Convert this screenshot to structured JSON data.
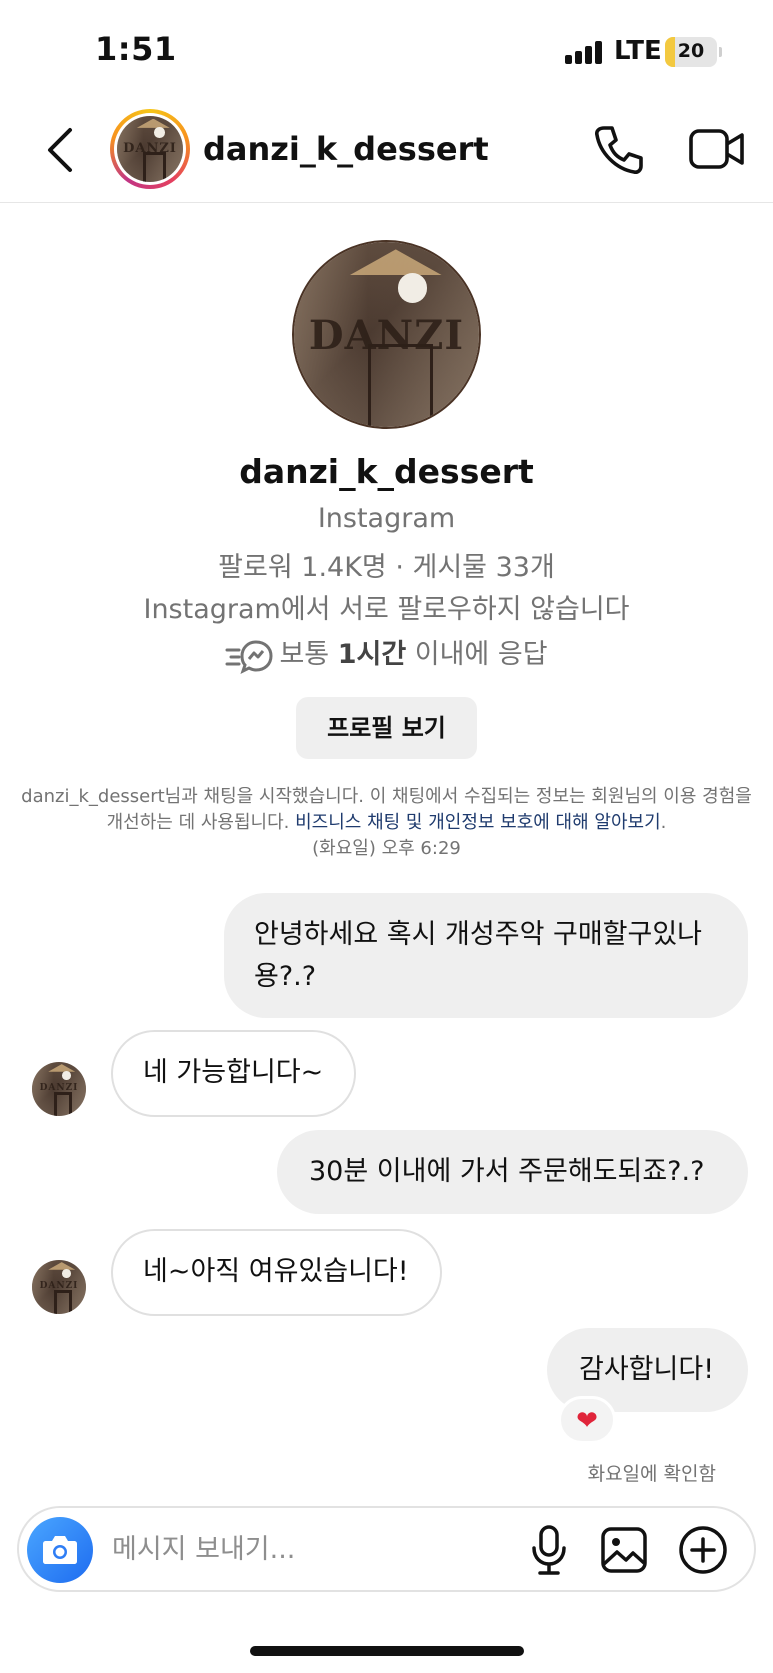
{
  "status_bar": {
    "time": "1:51",
    "network": "LTE",
    "battery": "20",
    "battery_level_percent": 20
  },
  "header": {
    "title": "danzi_k_dessert",
    "avatar_text": "DANZI"
  },
  "profile": {
    "avatar_text": "DANZI",
    "username": "danzi_k_dessert",
    "platform": "Instagram",
    "stats": "팔로워 1.4K명 · 게시물 33개",
    "follow_status": "Instagram에서 서로 팔로우하지 않습니다",
    "response_prefix": "보통 ",
    "response_time": "1시간",
    "response_suffix": " 이내에 응답",
    "view_profile_label": "프로필 보기"
  },
  "notice": {
    "text": "danzi_k_dessert님과 채팅을 시작했습니다. 이 채팅에서 수집되는 정보는 회원님의 이용 경험을 개선하는 데 사용됩니다. ",
    "link": "비즈니스 채팅 및 개인정보 보호에 대해 알아보기",
    "link_suffix": ".",
    "timestamp": "(화요일) 오후 6:29"
  },
  "messages": [
    {
      "from": "me",
      "text_line1": "안녕하세요 혹시 개성주악 구매할구있나",
      "text_line2": "용?.?"
    },
    {
      "from": "them",
      "text": "네 가능합니다~"
    },
    {
      "from": "me",
      "text": "30분 이내에 가서 주문해도되죠?.?"
    },
    {
      "from": "them",
      "text": "네~아직 여유있습니다!"
    },
    {
      "from": "me",
      "text": "감사합니다!",
      "reaction": "❤"
    }
  ],
  "seen_status": "화요일에 확인함",
  "composer": {
    "placeholder": "메시지 보내기..."
  },
  "colors": {
    "outgoing_bubble": "#efefef",
    "incoming_border": "#e0e0e0",
    "camera_button": "#1e6cf0",
    "link": "#1f3b6e",
    "reaction_heart": "#e0243a"
  }
}
